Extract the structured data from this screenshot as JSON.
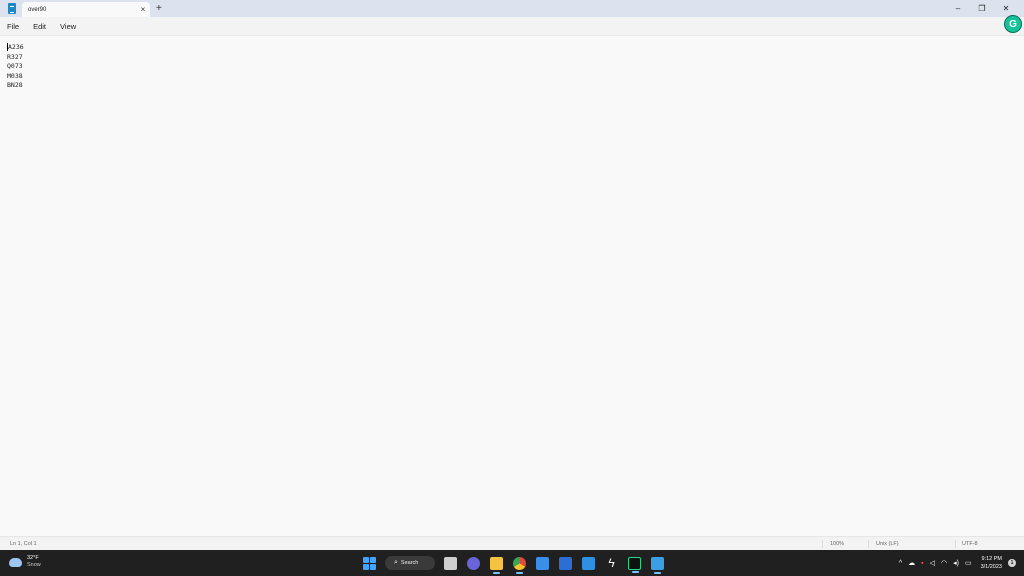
{
  "window": {
    "tab_title": "over90",
    "tab_close": "×",
    "new_tab": "+",
    "minimize": "–",
    "restore": "❐",
    "close": "✕"
  },
  "menu": {
    "items": [
      "File",
      "Edit",
      "View"
    ]
  },
  "grammarly": {
    "letter": "G",
    "color": "#15c39a"
  },
  "editor": {
    "lines": [
      "A236",
      "R327",
      "Q073",
      "M038",
      "BN28"
    ]
  },
  "status": {
    "position": "Ln 1, Col 1",
    "zoom": "100%",
    "line_ending": "Unix (LF)",
    "encoding": "UTF-8"
  },
  "taskbar": {
    "weather_temp": "32°F",
    "weather_condition": "Snow",
    "search_label": "Search",
    "clock_time": "9:12 PM",
    "clock_date": "3/1/2023",
    "notification_count": "1",
    "apps": [
      {
        "name": "task-view-icon",
        "color": "#cfcfcf"
      },
      {
        "name": "teams-chat-icon",
        "color": "#6b63d9"
      },
      {
        "name": "file-explorer-icon",
        "color": "#f5c242"
      },
      {
        "name": "chrome-icon",
        "color": "#e8453c"
      },
      {
        "name": "microsoft-store-icon",
        "color": "#3b8ee8"
      },
      {
        "name": "word-icon",
        "color": "#2b6fd6"
      },
      {
        "name": "mail-icon",
        "color": "#2f8fe0"
      },
      {
        "name": "bolt-app-icon",
        "color": "#ffffff"
      },
      {
        "name": "pycharm-icon",
        "color": "#21d789"
      },
      {
        "name": "notepad-icon",
        "color": "#3aa0e6"
      }
    ]
  }
}
